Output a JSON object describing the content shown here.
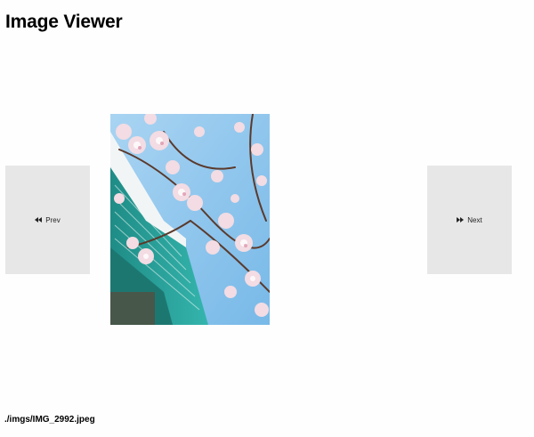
{
  "header": {
    "title": "Image Viewer"
  },
  "controls": {
    "prev_label": "Prev",
    "next_label": "Next",
    "prev_icon": "rewind-icon",
    "next_icon": "fast-forward-icon"
  },
  "viewer": {
    "current_path": "./imgs/IMG_2992.jpeg"
  },
  "colors": {
    "page_background": "#fefefe",
    "button_background": "#e8e7e8",
    "sky": "#8fc3ea",
    "building_teal": "#2aa19b",
    "blossom": "#f3dce3"
  }
}
